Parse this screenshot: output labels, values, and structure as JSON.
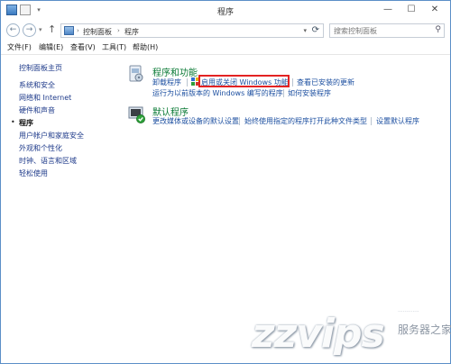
{
  "window": {
    "title": "程序",
    "buttons": {
      "minimize": "—",
      "maximize": "☐",
      "close": "✕"
    }
  },
  "address": {
    "back_icon": "back-arrow-icon",
    "forward_icon": "forward-arrow-icon",
    "path": [
      "控制面板",
      "程序"
    ],
    "separator": "›",
    "search_placeholder": "搜索控制面板"
  },
  "menu": {
    "items": [
      "文件(F)",
      "编辑(E)",
      "查看(V)",
      "工具(T)",
      "帮助(H)"
    ]
  },
  "leftnav": {
    "home": "控制面板主页",
    "items": [
      "系统和安全",
      "网络和 Internet",
      "硬件和声音",
      "程序",
      "用户帐户和家庭安全",
      "外观和个性化",
      "时钟、语言和区域",
      "轻松使用"
    ],
    "current_index": 3
  },
  "programs": {
    "title": "程序和功能",
    "links": [
      "卸载程序",
      "启用或关闭 Windows 功能",
      "查看已安装的更新",
      "运行为以前版本的 Windows 编写的程序",
      "如何安装程序"
    ]
  },
  "defaults": {
    "title": "默认程序",
    "links": [
      "更改媒体或设备的默认设置",
      "始终使用指定的程序打开此种文件类型",
      "设置默认程序"
    ]
  },
  "watermark": {
    "main": "zzvips",
    "cn": "服务器之家",
    "dots": "· · · · · · · · · · · · ·"
  },
  "colors": {
    "section_title": "#0a7a35",
    "link": "#1c4fa0",
    "highlight": "#e32222"
  }
}
